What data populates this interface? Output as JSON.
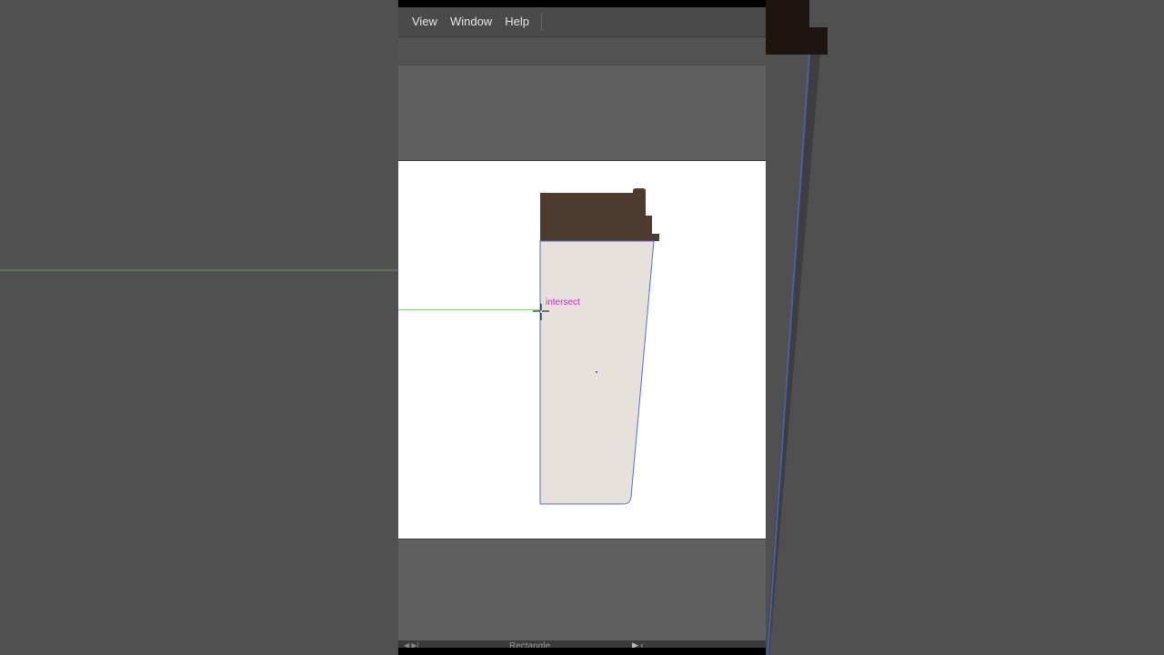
{
  "menubar": {
    "items": [
      {
        "label": "View"
      },
      {
        "label": "Window"
      },
      {
        "label": "Help"
      }
    ]
  },
  "canvas": {
    "smart_guide_label": "intersect"
  },
  "statusbar": {
    "tool_label": "Rectangle",
    "nav_arrows": "◀ ▶|",
    "play": "▶ ‹"
  },
  "colors": {
    "lid": "#4d3b2f",
    "cup_body": "#e7e1dc",
    "path_stroke": "#4f6fd0",
    "smart_guide": "#d41ed4",
    "guide_line": "#8fcf7a"
  }
}
